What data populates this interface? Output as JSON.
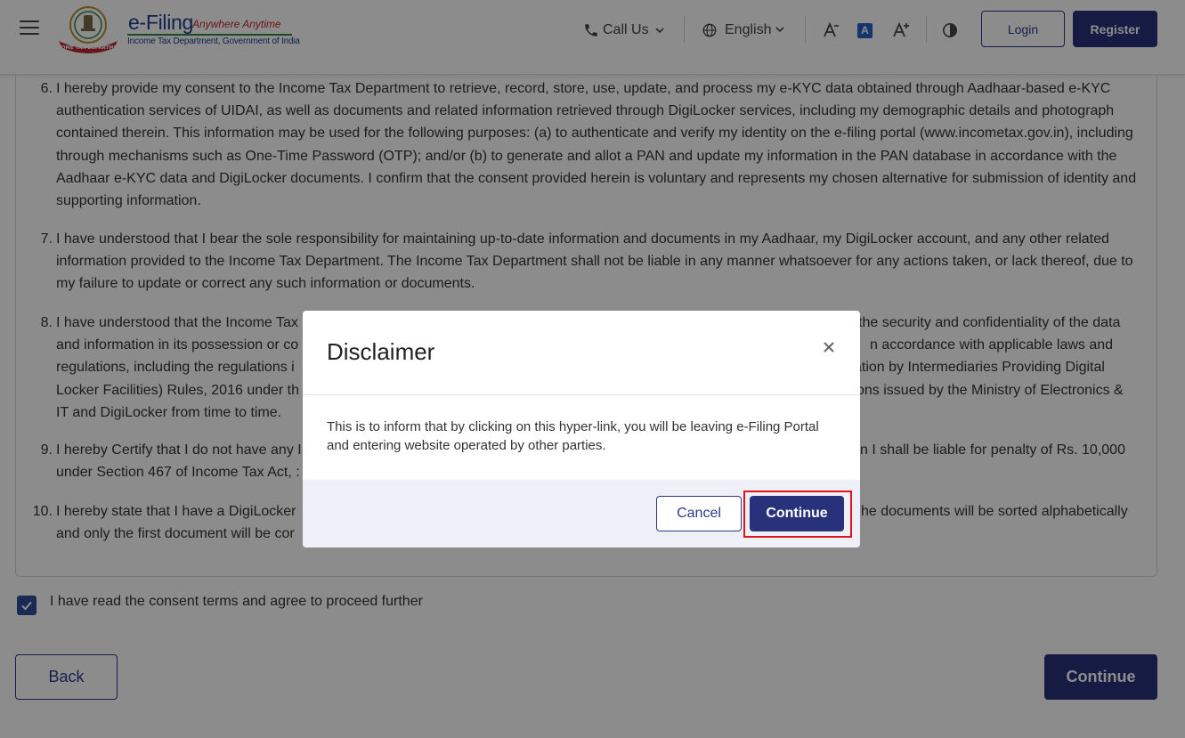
{
  "header": {
    "brand_title": "e-Filing",
    "brand_tagline": "Anywhere Anytime",
    "brand_subtitle": "Income Tax Department, Government of India",
    "emblem_text": "INCOME TAX DEPARTMENT",
    "call_us_label": "Call Us",
    "language_label": "English",
    "font_decrease_icon": "text-decrease-icon",
    "font_normal_label": "A",
    "font_increase_icon": "text-increase-icon",
    "contrast_icon": "contrast-icon",
    "login_label": "Login",
    "register_label": "Register"
  },
  "terms": [
    {
      "num": "6.",
      "text": "I hereby provide my consent to the Income Tax Department to retrieve, record, store, use, update, and process my e-KYC data obtained through Aadhaar-based e-KYC authentication services of UIDAI, as well as documents and related information retrieved through DigiLocker services, including my demographic details and photograph contained therein. This information may be used for the following purposes: (a) to authenticate and verify my identity on the e-filing portal (www.incometax.gov.in), including through mechanisms such as One-Time Password (OTP); and/or (b) to generate and allot a PAN and update my information in the PAN database in accordance with the Aadhaar e-KYC data and DigiLocker documents. I confirm that the consent provided herein is voluntary and represents my chosen alternative for submission of identity and supporting information."
    },
    {
      "num": "7.",
      "text": "I have understood that I bear the sole responsibility for maintaining up-to-date information and documents in my Aadhaar, my DigiLocker account, and any other related information provided to the Income Tax Department. The Income Tax Department shall not be liable in any manner whatsoever for any actions taken, or lack thereof, due to my failure to update or correct any such information or documents."
    },
    {
      "num": "8.",
      "line1_left": "I have understood that the Income Tax",
      "line1_right": "the security and confidentiality of the data",
      "line2_left": "and information in its possession or co",
      "line2_right": "n accordance with applicable laws and",
      "line3_left": "regulations, including the regulations i",
      "line3_right": "ation by Intermediaries Providing Digital",
      "line4_left": "Locker Facilities) Rules, 2016 under th",
      "line4_right": "ons issued by the Ministry of Electronics &",
      "line5": "IT and DigiLocker from time to time."
    },
    {
      "num": "9.",
      "line1_left": "I hereby Certify that I do not have any I",
      "line1_right": "n I shall be liable for penalty of Rs. 10,000",
      "line2_left": "under Section 467 of Income Tax Act, :"
    },
    {
      "num": "10.",
      "line1_left": "I hereby state that I have a DigiLocker",
      "line1_right": "he documents will be sorted alphabetically",
      "line2_left": "and only the first document will be cor"
    }
  ],
  "consent": {
    "checked": true,
    "label": "I have read the consent terms and agree to proceed further"
  },
  "actions": {
    "back_label": "Back",
    "continue_label": "Continue"
  },
  "modal": {
    "title": "Disclaimer",
    "body": "This is to inform that by clicking on this hyper-link, you will be leaving e-Filing Portal and entering website operated by other parties.",
    "cancel_label": "Cancel",
    "continue_label": "Continue"
  },
  "colors": {
    "primary": "#27327a",
    "highlight": "#e0151a",
    "checkbox": "#2e4d9c"
  }
}
